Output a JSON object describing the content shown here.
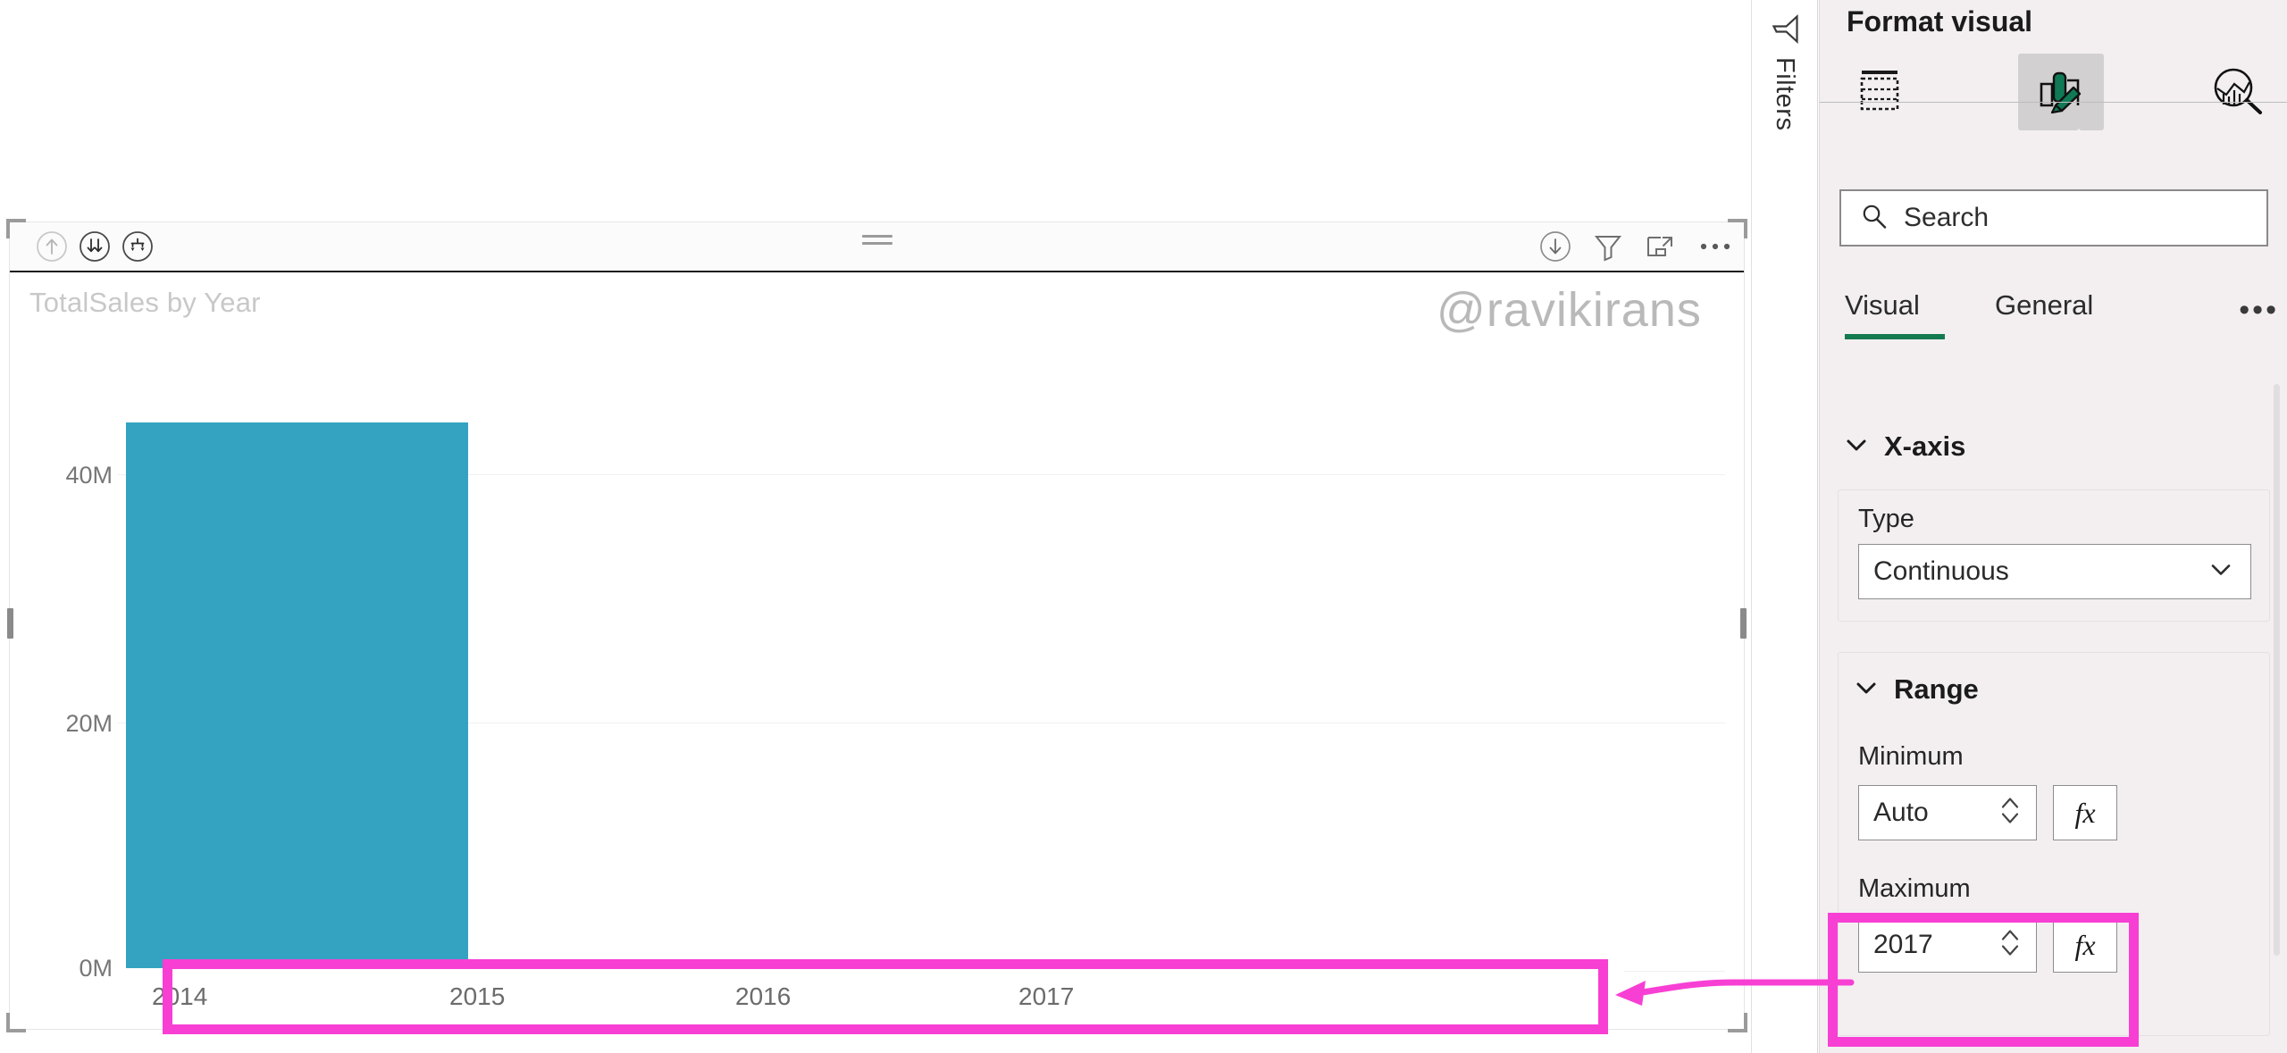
{
  "canvas": {
    "visual": {
      "title": "TotalSales by Year",
      "drill_icons": [
        {
          "name": "drill-up-icon",
          "label": "Drill up"
        },
        {
          "name": "drill-down-icon",
          "label": "Drill down"
        },
        {
          "name": "expand-hierarchy-icon",
          "label": "Expand all down one level in the hierarchy"
        }
      ],
      "header_icons": [
        {
          "name": "drill-mode-icon",
          "label": "Drill on"
        },
        {
          "name": "filter-icon",
          "label": "Filters"
        },
        {
          "name": "focus-mode-icon",
          "label": "Focus mode"
        },
        {
          "name": "more-options-icon",
          "label": "More options"
        }
      ]
    }
  },
  "filters_rail": {
    "label": "Filters",
    "icon": "filter-funnel-icon"
  },
  "format_panel": {
    "title": "Format visual",
    "tabs": [
      {
        "name": "fields-tab",
        "icon": "table-fields-icon",
        "selected": false
      },
      {
        "name": "format-tab",
        "icon": "paint-brush-icon",
        "selected": true
      },
      {
        "name": "analytics-tab",
        "icon": "magnifier-chart-icon",
        "selected": false
      }
    ],
    "search": {
      "placeholder": "Search",
      "value": "",
      "icon": "search-icon"
    },
    "subtabs": [
      {
        "label": "Visual",
        "selected": true
      },
      {
        "label": "General",
        "selected": false
      }
    ],
    "more_label": "•••",
    "sections": [
      {
        "name": "x-axis",
        "label": "X-axis",
        "expanded": true,
        "fields": [
          {
            "label": "Type",
            "control": "dropdown",
            "value": "Continuous"
          }
        ],
        "subsections": [
          {
            "name": "range",
            "label": "Range",
            "expanded": true,
            "fields": [
              {
                "label": "Minimum",
                "control": "spinner",
                "value": "Auto",
                "fx": "fx"
              },
              {
                "label": "Maximum",
                "control": "spinner",
                "value": "2017",
                "fx": "fx",
                "highlighted": true
              }
            ]
          }
        ]
      }
    ]
  },
  "watermark": "@ravikirans",
  "annotation": {
    "color": "#f83fd4",
    "arrow_from": "maximum-field",
    "arrow_to": "x-axis-labels"
  },
  "chart_data": {
    "type": "bar",
    "title": "TotalSales by Year",
    "xlabel": "",
    "ylabel": "",
    "categories": [
      "2014",
      "2015",
      "2016",
      "2017"
    ],
    "values": [
      44000000,
      0,
      0,
      0
    ],
    "ytick_labels": [
      "40M",
      "20M",
      "0M"
    ],
    "ytick_values": [
      40000000,
      20000000,
      0
    ],
    "ylim": [
      0,
      48000000
    ],
    "xlim": [
      "2014",
      "2017"
    ],
    "grid": true,
    "legend": "none",
    "bar_color": "#33a3c1"
  }
}
